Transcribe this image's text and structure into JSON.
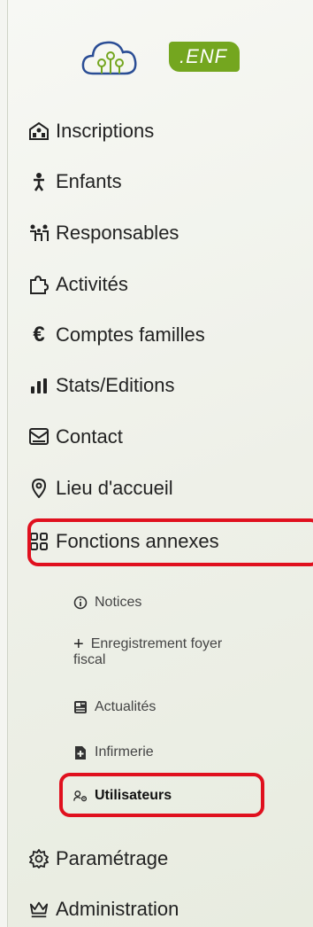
{
  "logo": {
    "badge": ".ENF"
  },
  "nav": {
    "inscriptions": "Inscriptions",
    "enfants": "Enfants",
    "responsables": "Responsables",
    "activites": "Activités",
    "comptes": "Comptes familles",
    "stats": "Stats/Editions",
    "contact": "Contact",
    "lieu": "Lieu d'accueil",
    "fonctions": "Fonctions annexes",
    "parametrage": "Paramétrage",
    "administration": "Administration"
  },
  "sub": {
    "notices": "Notices",
    "enregistrement_line1": "Enregistrement foyer",
    "enregistrement_line2": "fiscal",
    "actualites": "Actualités",
    "infirmerie": "Infirmerie",
    "utilisateurs": "Utilisateurs"
  },
  "colors": {
    "brand_green": "#74a61f",
    "highlight_red": "#e0101e"
  }
}
